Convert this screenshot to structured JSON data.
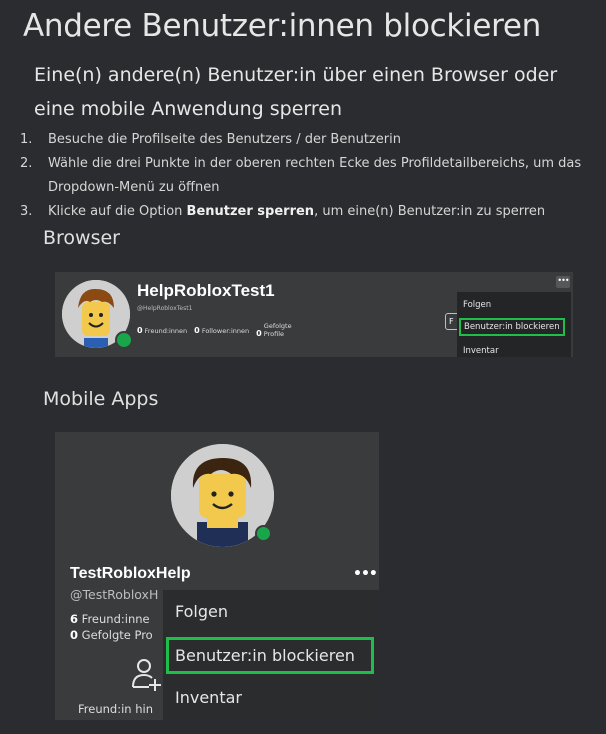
{
  "page": {
    "title": "Andere Benutzer:innen blockieren",
    "subtitle": "Eine(n) andere(n) Benutzer:in über einen Browser oder eine mobile Anwendung sperren",
    "steps": [
      {
        "num": "1.",
        "text": "Besuche die Profilseite des Benutzers / der Benutzerin"
      },
      {
        "num": "2.",
        "text": "Wähle die drei Punkte in der oberen rechten Ecke des Profildetailbereichs, um das Dropdown-Menü zu öffnen"
      },
      {
        "num": "3.",
        "pre": "Klicke auf die Option ",
        "bold": "Benutzer sperren",
        "post": ", um eine(n) Benutzer:in zu sperren"
      }
    ],
    "browser_heading": "Browser",
    "mobile_heading": "Mobile Apps"
  },
  "browser_mock": {
    "username": "HelpRobloxTest1",
    "handle": "@HelpRobloxTest1",
    "friends_count": "0",
    "friends_label": "Freund:innen",
    "followers_count": "0",
    "followers_label": "Follower:innen",
    "following_count": "0",
    "following_label_1": "Gefolgte",
    "following_label_2": "Profile",
    "partial_button": "F",
    "dots": "•••",
    "menu": {
      "follow": "Folgen",
      "block": "Benutzer:in blockieren",
      "inventory": "Inventar"
    }
  },
  "mobile_mock": {
    "username": "TestRobloxHelp",
    "handle": "@TestRobloxH",
    "friends_count": "6",
    "friends_label": "Freund:inne",
    "following_count": "0",
    "following_label": "Gefolgte Pro",
    "add_friend_label": "Freund:in hin",
    "dots": "•••",
    "menu": {
      "follow": "Folgen",
      "block": "Benutzer:in blockieren",
      "inventory": "Inventar"
    }
  },
  "colors": {
    "background": "#2b2c2f",
    "card": "#393b3d",
    "highlight": "#1fbe4a",
    "online": "#19a64a"
  }
}
